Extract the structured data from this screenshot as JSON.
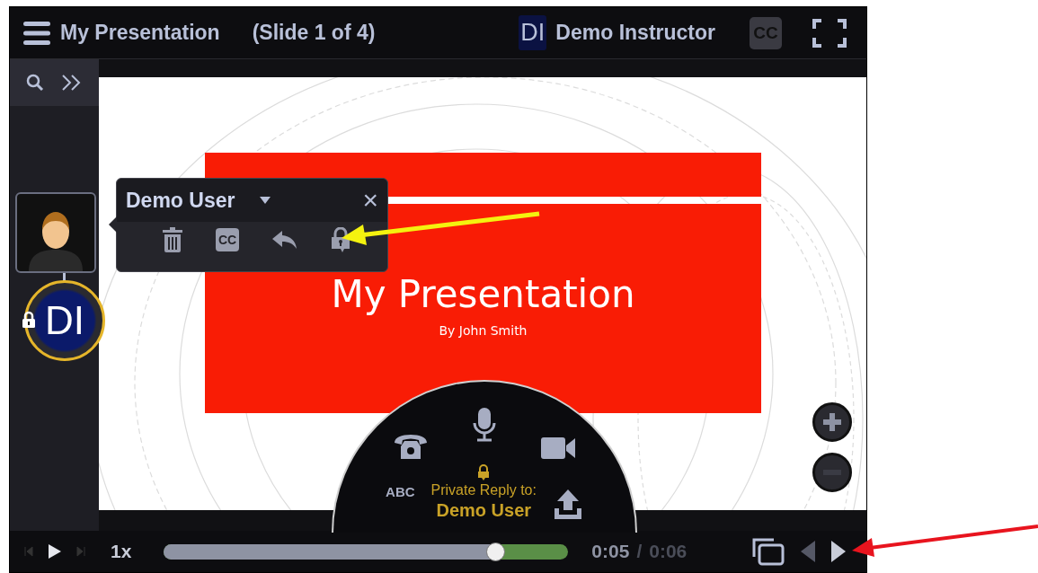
{
  "header": {
    "title": "My Presentation",
    "slide_info": "(Slide 1 of 4)",
    "instructor": {
      "initials": "DI",
      "name": "Demo Instructor"
    },
    "cc": "CC"
  },
  "sidebar": {
    "participant": {
      "initials": "DI",
      "locked": true
    }
  },
  "popup": {
    "name": "Demo User",
    "close": "×",
    "cc": "CC"
  },
  "slide": {
    "title": "My Presentation",
    "subtitle": "By John Smith"
  },
  "composer": {
    "abc": "ABC",
    "private_label": "Private Reply to:",
    "recipient": "Demo User"
  },
  "player": {
    "speed": "1x",
    "level": 0.82,
    "current": "0:05",
    "separator": "/",
    "total": "0:06"
  }
}
